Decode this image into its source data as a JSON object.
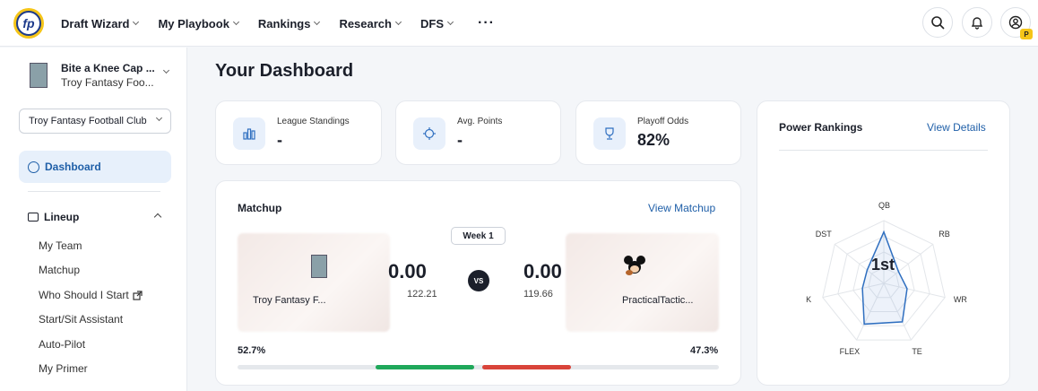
{
  "nav": {
    "logo_text": "fp",
    "items": [
      "Draft Wizard",
      "My Playbook",
      "Rankings",
      "Research",
      "DFS"
    ],
    "more": "···",
    "profile_badge": "P"
  },
  "sidebar": {
    "team_name": "Bite a Knee Cap ...",
    "team_league": "Troy Fantasy Foo...",
    "league_select": "Troy Fantasy Football Club",
    "dashboard": "Dashboard",
    "lineup": "Lineup",
    "lineup_items": [
      "My Team",
      "Matchup",
      "Who Should I Start",
      "Start/Sit Assistant",
      "Auto-Pilot",
      "My Primer"
    ]
  },
  "main": {
    "title": "Your Dashboard",
    "stats": [
      {
        "label": "League Standings",
        "value": "-"
      },
      {
        "label": "Avg. Points",
        "value": "-"
      },
      {
        "label": "Playoff Odds",
        "value": "82%"
      }
    ],
    "matchup": {
      "title": "Matchup",
      "link": "View Matchup",
      "week": "Week 1",
      "vs": "VS",
      "home": {
        "name": "Troy Fantasy F...",
        "score": "0.00",
        "projected": "122.21",
        "win_pct": "52.7%",
        "win_value": 52.7
      },
      "away": {
        "name": "PracticalTactic...",
        "score": "0.00",
        "projected": "119.66",
        "win_pct": "47.3%",
        "win_value": 47.3
      },
      "colors": {
        "home": "#1fa85a",
        "away": "#d9443a"
      }
    },
    "power_rankings": {
      "title": "Power Rankings",
      "link": "View Details",
      "rank": "1st",
      "axes": [
        "QB",
        "RB",
        "WR",
        "TE",
        "FLEX",
        "K",
        "DST"
      ],
      "values": [
        0.82,
        0.3,
        0.38,
        0.68,
        0.72,
        0.35,
        0.34
      ]
    }
  }
}
